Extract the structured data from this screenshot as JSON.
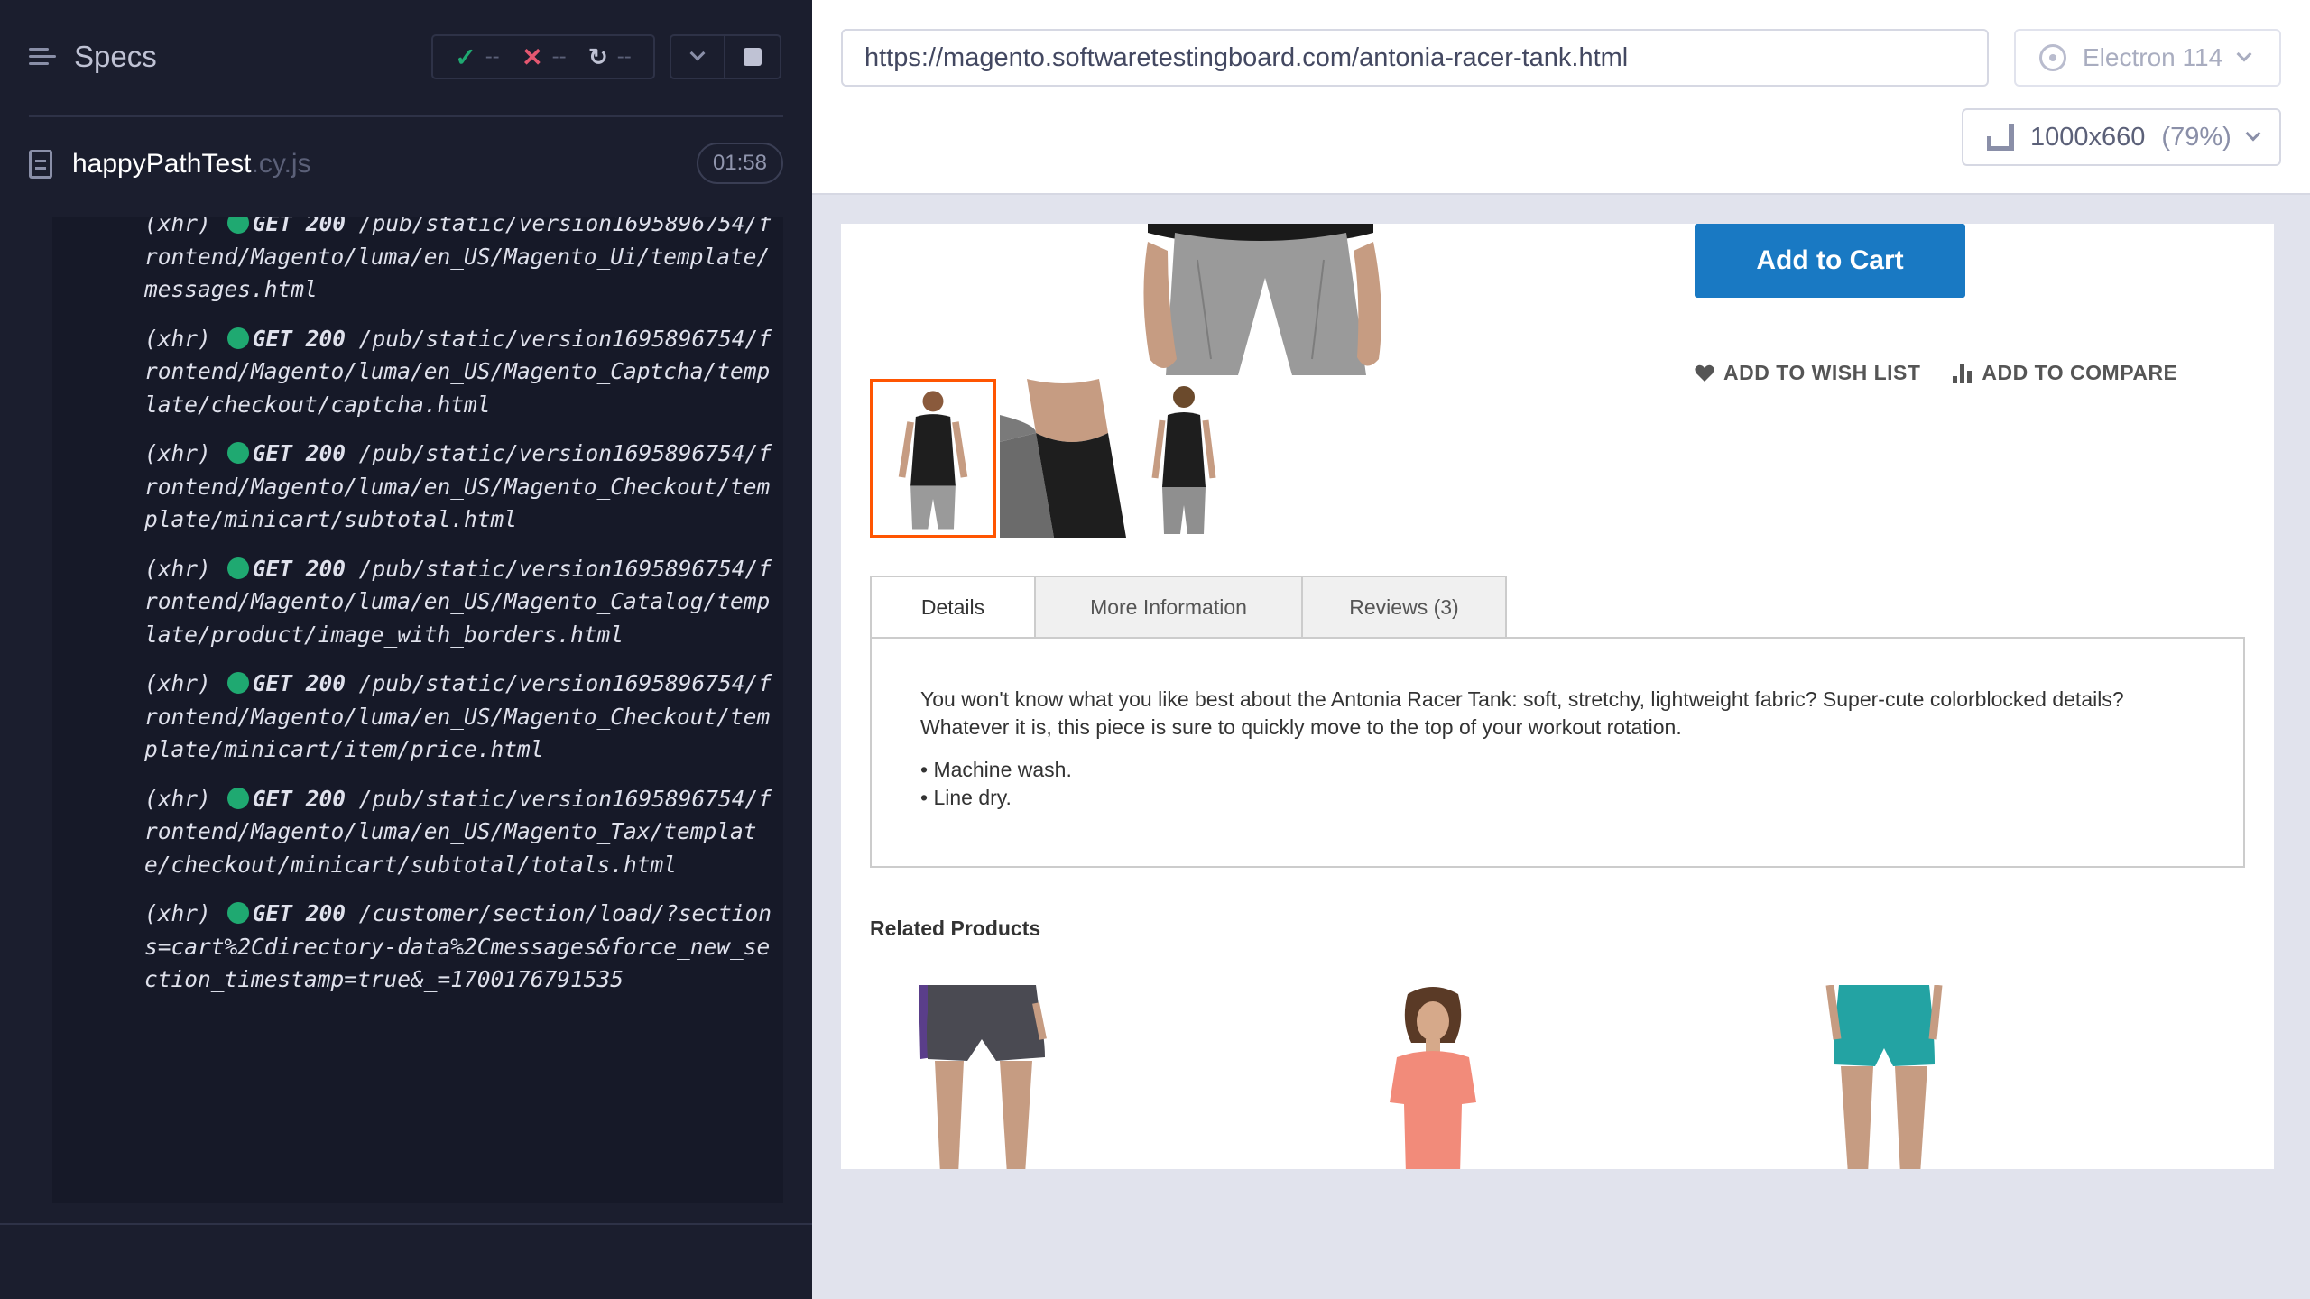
{
  "reporter": {
    "specs_label": "Specs",
    "stats": {
      "passed": "--",
      "failed": "--",
      "pending": "--"
    },
    "spec_file": {
      "name": "happyPathTest",
      "ext": ".cy.js",
      "duration": "01:58"
    },
    "log": [
      {
        "type": "(xhr)",
        "status": "GET 200",
        "url": "/pub/static/version1695896754/frontend/Magento/luma/en_US/Magento_Ui/template/messages.html"
      },
      {
        "type": "(xhr)",
        "status": "GET 200",
        "url": "/pub/static/version1695896754/frontend/Magento/luma/en_US/Magento_Captcha/template/checkout/captcha.html"
      },
      {
        "type": "(xhr)",
        "status": "GET 200",
        "url": "/pub/static/version1695896754/frontend/Magento/luma/en_US/Magento_Checkout/template/minicart/subtotal.html"
      },
      {
        "type": "(xhr)",
        "status": "GET 200",
        "url": "/pub/static/version1695896754/frontend/Magento/luma/en_US/Magento_Catalog/template/product/image_with_borders.html"
      },
      {
        "type": "(xhr)",
        "status": "GET 200",
        "url": "/pub/static/version1695896754/frontend/Magento/luma/en_US/Magento_Checkout/template/minicart/item/price.html"
      },
      {
        "type": "(xhr)",
        "status": "GET 200",
        "url": "/pub/static/version1695896754/frontend/Magento/luma/en_US/Magento_Tax/template/checkout/minicart/subtotal/totals.html"
      },
      {
        "type": "(xhr)",
        "status": "GET 200",
        "url": "/customer/section/load/?sections=cart%2Cdirectory-data%2Cmessages&force_new_section_timestamp=true&_=1700176791535"
      }
    ]
  },
  "browser": {
    "url": "https://magento.softwaretestingboard.com/antonia-racer-tank.html",
    "browser_name": "Electron 114",
    "viewport": "1000x660",
    "zoom": "(79%)"
  },
  "product": {
    "add_to_cart": "Add to Cart",
    "wish_list": "ADD TO WISH LIST",
    "compare": "ADD TO COMPARE",
    "tabs": [
      "Details",
      "More Information",
      "Reviews (3)"
    ],
    "description": "You won't know what you like best about the Antonia Racer Tank: soft, stretchy, lightweight fabric? Super-cute colorblocked details? Whatever it is, this piece is sure to quickly move to the top of your workout rotation.",
    "care": [
      "• Machine wash.",
      "• Line dry."
    ],
    "related_title": "Related Products"
  },
  "colors": {
    "accent_blue": "#1979c3",
    "thumb_active": "#ff5501",
    "status_green": "#1fa971"
  }
}
